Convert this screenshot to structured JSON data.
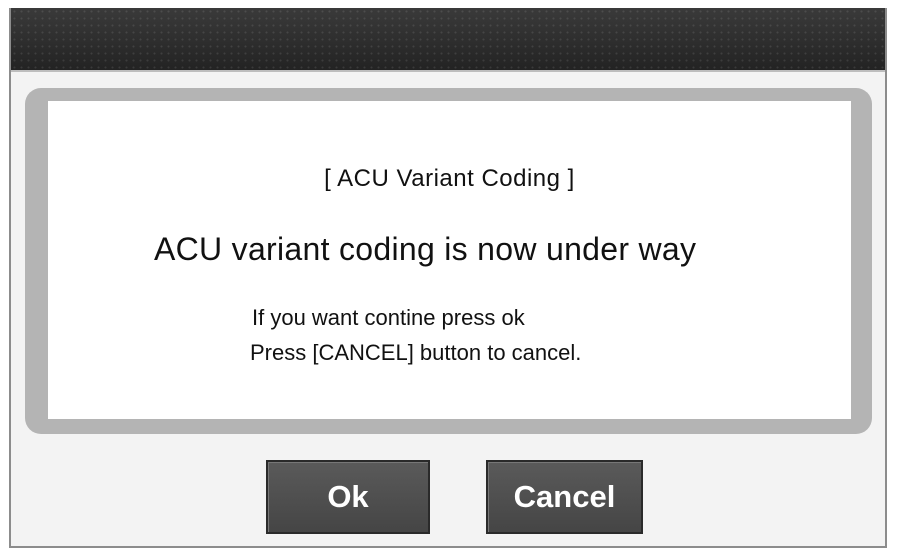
{
  "dialog": {
    "title": "[ ACU Variant Coding ]",
    "headline": "ACU variant coding is now under way",
    "line1": "If you want contine press ok",
    "line2": "Press [CANCEL] button to cancel."
  },
  "buttons": {
    "ok_label": "Ok",
    "cancel_label": "Cancel"
  },
  "colors": {
    "titlebar": "#2e2e2e",
    "frame": "#b4b4b4",
    "button": "#4f4f4f",
    "button_text": "#ffffff"
  }
}
